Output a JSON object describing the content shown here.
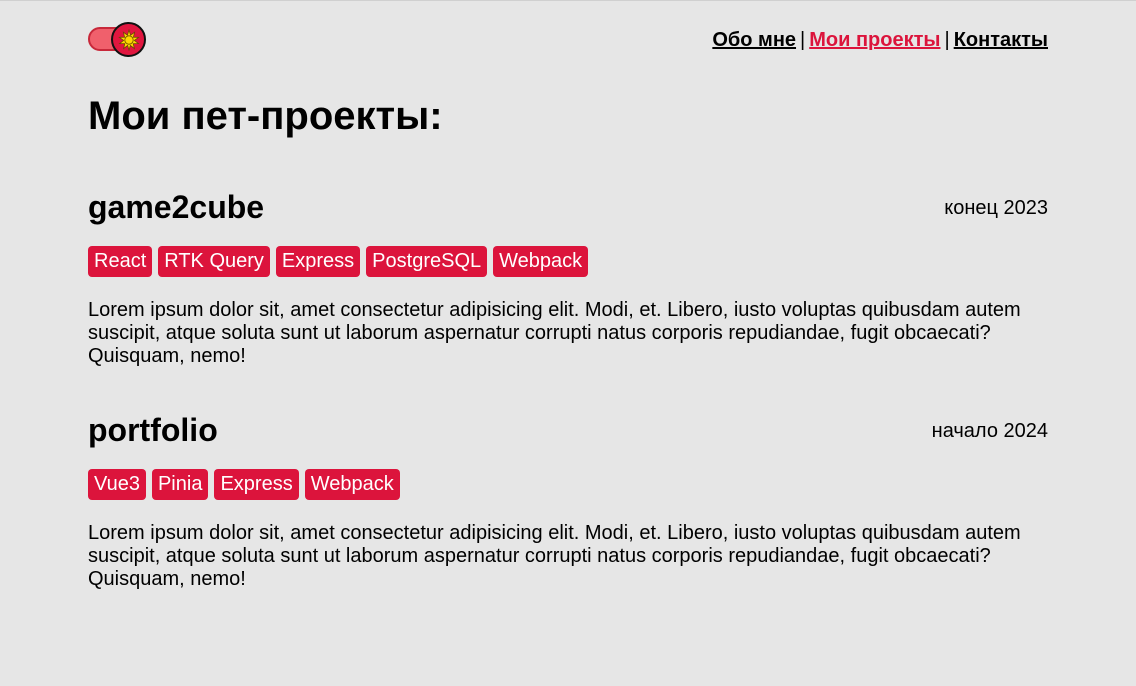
{
  "header": {
    "theme_toggle": {
      "state": "on"
    },
    "nav": {
      "about": "Обо мне",
      "separator_1": "|",
      "projects": "Мои проекты",
      "separator_2": "|",
      "contacts": "Контакты",
      "active": "projects"
    }
  },
  "main": {
    "title": "Мои пет-проекты:",
    "projects": [
      {
        "title": "game2cube",
        "date": "конец 2023",
        "tags": [
          "React",
          "RTK Query",
          "Express",
          "PostgreSQL",
          "Webpack"
        ],
        "description": "Lorem ipsum dolor sit, amet consectetur adipisicing elit. Modi, et. Libero, iusto voluptas quibusdam autem suscipit, atque soluta sunt ut laborum aspernatur corrupti natus corporis repudiandae, fugit obcaecati? Quisquam, nemo!"
      },
      {
        "title": "portfolio",
        "date": "начало 2024",
        "tags": [
          "Vue3",
          "Pinia",
          "Express",
          "Webpack"
        ],
        "description": "Lorem ipsum dolor sit, amet consectetur adipisicing elit. Modi, et. Libero, iusto voluptas quibusdam autem suscipit, atque soluta sunt ut laborum aspernatur corrupti natus corporis repudiandae, fugit obcaecati? Quisquam, nemo!"
      }
    ]
  },
  "colors": {
    "background": "#e6e6e6",
    "accent": "#dc143c",
    "tag_text": "#ffffff",
    "text": "#000000",
    "sun_icon": "#ffd700"
  },
  "icons": {
    "theme_toggle_knob": "sun-icon"
  }
}
